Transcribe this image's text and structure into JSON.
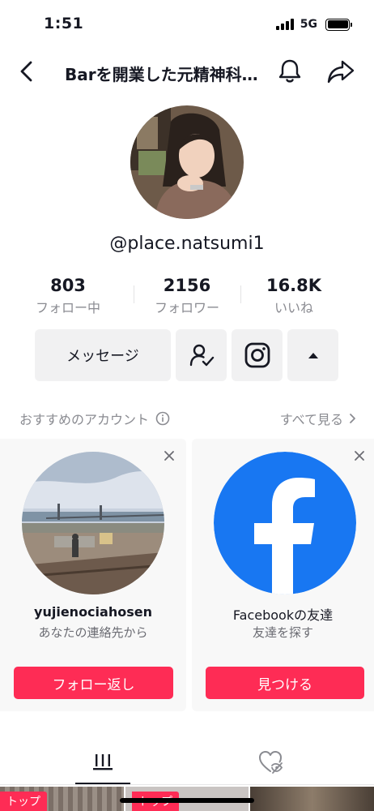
{
  "status_bar": {
    "time": "1:51",
    "network": "5G"
  },
  "nav": {
    "title": "Barを開業した元精神科ナース",
    "icons": {
      "back": "chevron-left-icon",
      "bell": "bell-icon",
      "share": "share-icon"
    }
  },
  "profile": {
    "username": "@place.natsumi1",
    "stats": [
      {
        "value": "803",
        "label": "フォロー中"
      },
      {
        "value": "2156",
        "label": "フォロワー"
      },
      {
        "value": "16.8K",
        "label": "いいね"
      }
    ]
  },
  "actions": {
    "message_label": "メッセージ",
    "icons": [
      "person-check-icon",
      "instagram-icon",
      "caret-up-icon"
    ]
  },
  "suggestions": {
    "title": "おすすめのアカウント",
    "see_all": "すべて見る",
    "cards": [
      {
        "name": "yujienociahosen",
        "subtitle": "あなたの連絡先から",
        "button": "フォロー返し"
      },
      {
        "name": "Facebookの友達",
        "subtitle": "友達を探す",
        "button": "見つける"
      }
    ]
  },
  "tabs": [
    {
      "name": "videos",
      "icon": "grid-bars-icon",
      "active": true
    },
    {
      "name": "liked",
      "icon": "hidden-heart-icon",
      "active": false
    }
  ],
  "grid": {
    "badge": "トップ"
  },
  "colors": {
    "accent": "#fe2c55",
    "facebook": "#1877f2",
    "text": "#161823",
    "muted": "#8a8b91"
  }
}
